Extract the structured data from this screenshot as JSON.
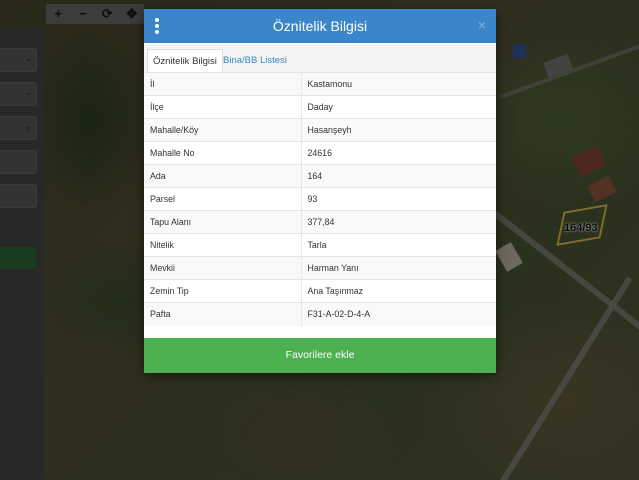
{
  "map": {
    "toolbar": [
      {
        "name": "zoom-in",
        "glyph": "+"
      },
      {
        "name": "zoom-out",
        "glyph": "−"
      },
      {
        "name": "refresh",
        "glyph": "⟳"
      },
      {
        "name": "locate",
        "glyph": "✥"
      }
    ],
    "parcel_label": "164/93"
  },
  "modal": {
    "title": "Öznitelik Bilgisi",
    "close_glyph": "×",
    "tabs": [
      {
        "label": "Öznitelik Bilgisi",
        "active": true
      },
      {
        "label": "Bina/BB Listesi",
        "active": false
      }
    ],
    "rows": [
      {
        "key": "İl",
        "value": "Kastamonu"
      },
      {
        "key": "İlçe",
        "value": "Daday"
      },
      {
        "key": "Mahalle/Köy",
        "value": "Hasanşeyh"
      },
      {
        "key": "Mahalle No",
        "value": "24616"
      },
      {
        "key": "Ada",
        "value": "164"
      },
      {
        "key": "Parsel",
        "value": "93"
      },
      {
        "key": "Tapu Alanı",
        "value": "377,84"
      },
      {
        "key": "Nitelik",
        "value": "Tarla"
      },
      {
        "key": "Mevkii",
        "value": "Harman Yanı"
      },
      {
        "key": "Zemin Tip",
        "value": "Ana Taşınmaz"
      },
      {
        "key": "Pafta",
        "value": "F31-A-02-D-4-A"
      }
    ],
    "favorite_button": "Favorilere ekle"
  },
  "colors": {
    "header": "#3b86c9",
    "favorite": "#4caf50",
    "parcel_outline": "#e8c84a"
  }
}
